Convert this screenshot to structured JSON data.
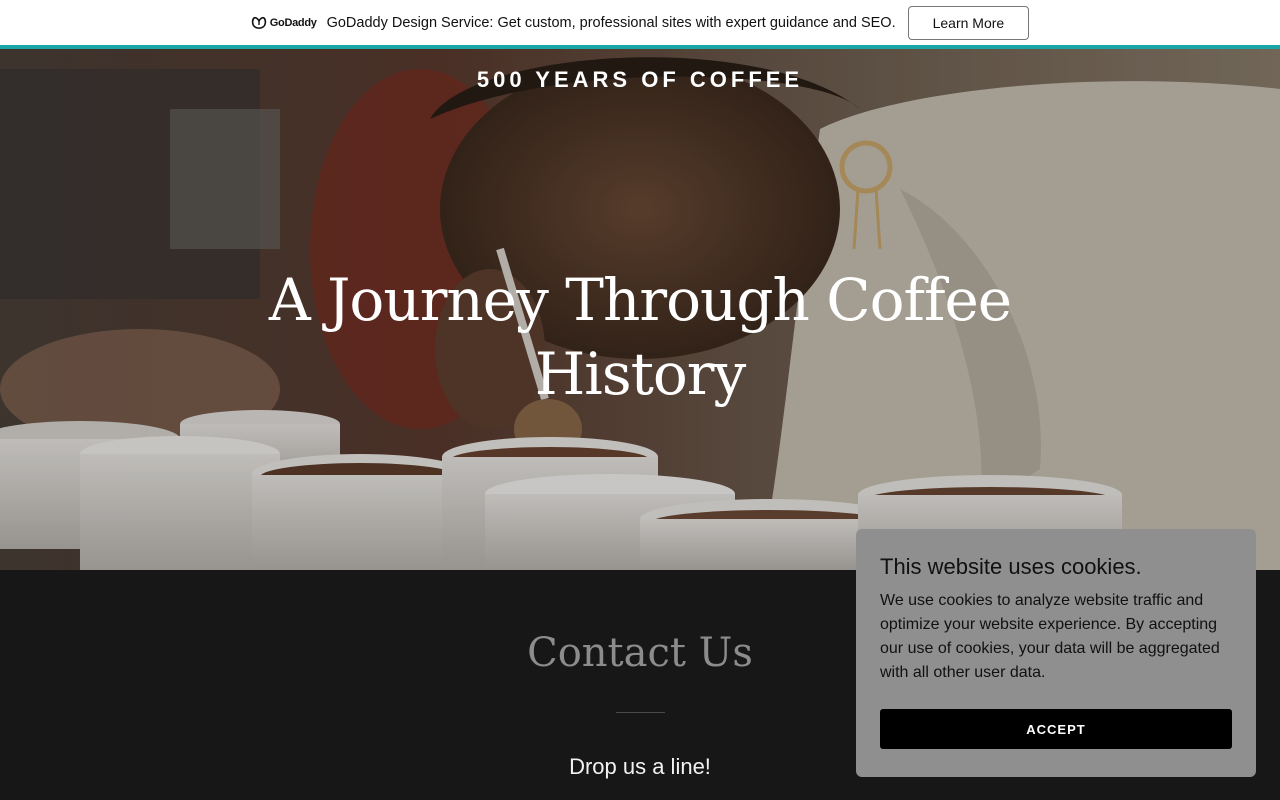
{
  "promo": {
    "logo_text": "GoDaddy",
    "message": "GoDaddy Design Service: Get custom, professional sites with expert guidance and SEO.",
    "cta_label": "Learn More"
  },
  "hero": {
    "site_title": "500 YEARS OF COFFEE",
    "heading": "A Journey Through Coffee History"
  },
  "contact": {
    "title": "Contact Us",
    "subtitle": "Drop us a line!"
  },
  "cookie": {
    "title": "This website uses cookies.",
    "body": "We use cookies to analyze website traffic and optimize your website experience. By accepting our use of cookies, your data will be aggregated with all other user data.",
    "accept_label": "ACCEPT"
  },
  "colors": {
    "accent_teal": "#1ba6a6",
    "dark_bg": "#171717",
    "cookie_bg": "#8f8f8f"
  }
}
